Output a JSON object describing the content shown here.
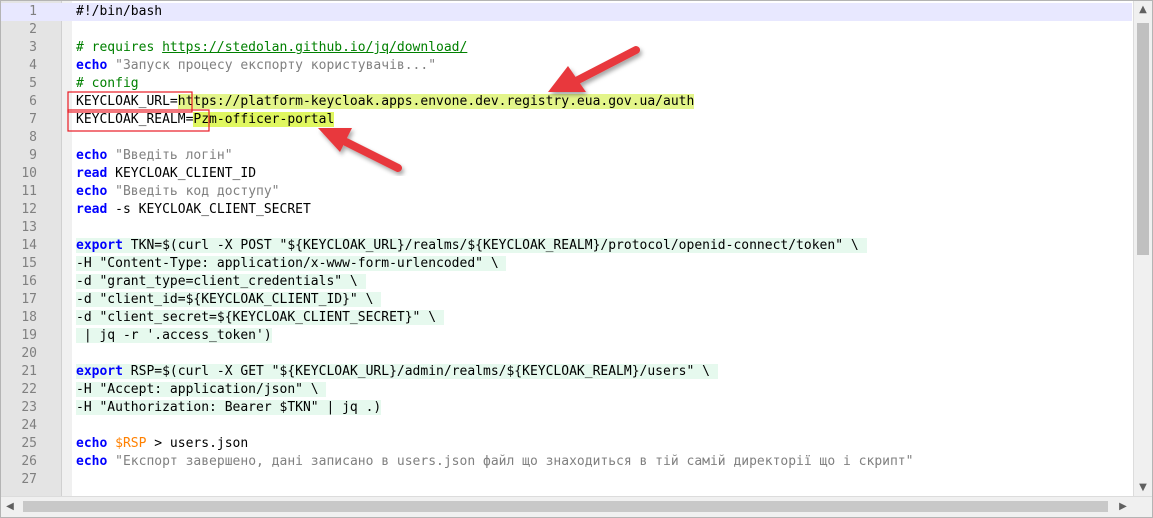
{
  "editor": {
    "current_line": 1,
    "lines": [
      {
        "n": "1",
        "tokens": [
          {
            "t": "#!/bin/bash",
            "c": "plain"
          }
        ]
      },
      {
        "n": "2",
        "tokens": []
      },
      {
        "n": "3",
        "tokens": [
          {
            "t": "# requires ",
            "c": "comment"
          },
          {
            "t": "https://stedolan.github.io/jq/download/",
            "c": "url"
          }
        ]
      },
      {
        "n": "4",
        "tokens": [
          {
            "t": "echo",
            "c": "keyword"
          },
          {
            "t": " ",
            "c": "plain"
          },
          {
            "t": "\"Запуск процесу експорту користувачів...\"",
            "c": "string"
          }
        ]
      },
      {
        "n": "5",
        "tokens": [
          {
            "t": "# config",
            "c": "comment"
          }
        ]
      },
      {
        "n": "6",
        "tokens": [
          {
            "t": "KEYCLOAK_URL=",
            "c": "plain"
          },
          {
            "t": "https://platform-keycloak.apps.envone.dev.registry.eua.gov.ua/auth",
            "c": "plain",
            "hl": "yellow"
          }
        ]
      },
      {
        "n": "7",
        "tokens": [
          {
            "t": "KEYCLOAK_REALM=",
            "c": "plain"
          },
          {
            "t": "Pzm-officer-portal",
            "c": "plain",
            "hl": "lime"
          }
        ]
      },
      {
        "n": "8",
        "tokens": []
      },
      {
        "n": "9",
        "tokens": [
          {
            "t": "echo",
            "c": "keyword"
          },
          {
            "t": " ",
            "c": "plain"
          },
          {
            "t": "\"Введіть логін\"",
            "c": "string"
          }
        ]
      },
      {
        "n": "10",
        "tokens": [
          {
            "t": "read",
            "c": "keyword"
          },
          {
            "t": " KEYCLOAK_CLIENT_ID",
            "c": "plain"
          }
        ]
      },
      {
        "n": "11",
        "tokens": [
          {
            "t": "echo",
            "c": "keyword"
          },
          {
            "t": " ",
            "c": "plain"
          },
          {
            "t": "\"Введіть код доступу\"",
            "c": "string"
          }
        ]
      },
      {
        "n": "12",
        "tokens": [
          {
            "t": "read",
            "c": "keyword"
          },
          {
            "t": " -s KEYCLOAK_CLIENT_SECRET",
            "c": "plain"
          }
        ]
      },
      {
        "n": "13",
        "tokens": []
      },
      {
        "n": "14",
        "tokens": [
          {
            "t": "export",
            "c": "keyword",
            "hl": "mint"
          },
          {
            "t": " TKN=$(curl -X POST \"${KEYCLOAK_URL}/realms/${KEYCLOAK_REALM}/protocol/openid-connect/token\" \\ ",
            "c": "plain",
            "hl": "mint"
          }
        ]
      },
      {
        "n": "15",
        "tokens": [
          {
            "t": "-H \"Content-Type: application/x-www-form-urlencoded\" \\ ",
            "c": "plain",
            "hl": "mint"
          }
        ]
      },
      {
        "n": "16",
        "tokens": [
          {
            "t": "-d \"grant_type=client_credentials\" \\ ",
            "c": "plain",
            "hl": "mint"
          }
        ]
      },
      {
        "n": "17",
        "tokens": [
          {
            "t": "-d \"client_id=${KEYCLOAK_CLIENT_ID}\" \\ ",
            "c": "plain",
            "hl": "mint"
          }
        ]
      },
      {
        "n": "18",
        "tokens": [
          {
            "t": "-d \"client_secret=${KEYCLOAK_CLIENT_SECRET}\" \\ ",
            "c": "plain",
            "hl": "mint"
          }
        ]
      },
      {
        "n": "19",
        "tokens": [
          {
            "t": " | jq -r '.access_token')",
            "c": "plain",
            "hl": "mint"
          }
        ]
      },
      {
        "n": "20",
        "tokens": []
      },
      {
        "n": "21",
        "tokens": [
          {
            "t": "export",
            "c": "keyword",
            "hl": "mint"
          },
          {
            "t": " RSP=$(curl -X GET \"${KEYCLOAK_URL}/admin/realms/${KEYCLOAK_REALM}/users\" \\ ",
            "c": "plain",
            "hl": "mint"
          }
        ]
      },
      {
        "n": "22",
        "tokens": [
          {
            "t": "-H \"Accept: application/json\" \\ ",
            "c": "plain",
            "hl": "mint"
          }
        ]
      },
      {
        "n": "23",
        "tokens": [
          {
            "t": "-H \"Authorization: Bearer $TKN\" | jq .)",
            "c": "plain",
            "hl": "mint"
          }
        ]
      },
      {
        "n": "24",
        "tokens": []
      },
      {
        "n": "25",
        "tokens": [
          {
            "t": "echo",
            "c": "keyword"
          },
          {
            "t": " ",
            "c": "plain"
          },
          {
            "t": "$RSP",
            "c": "var"
          },
          {
            "t": " > users.json",
            "c": "plain"
          }
        ]
      },
      {
        "n": "26",
        "tokens": [
          {
            "t": "echo",
            "c": "keyword"
          },
          {
            "t": " ",
            "c": "plain"
          },
          {
            "t": "\"Експорт завершено, дані записано в users.json файл що знаходиться в тій самій директорії що і скрипт\"",
            "c": "string"
          }
        ]
      },
      {
        "n": "27",
        "tokens": []
      }
    ]
  },
  "annotations": {
    "color": "#e8383d",
    "box_color": "#e81c24"
  },
  "scrollbars": {
    "up_icon": "▲",
    "down_icon": "▼",
    "left_icon": "◀",
    "right_icon": "▶"
  }
}
